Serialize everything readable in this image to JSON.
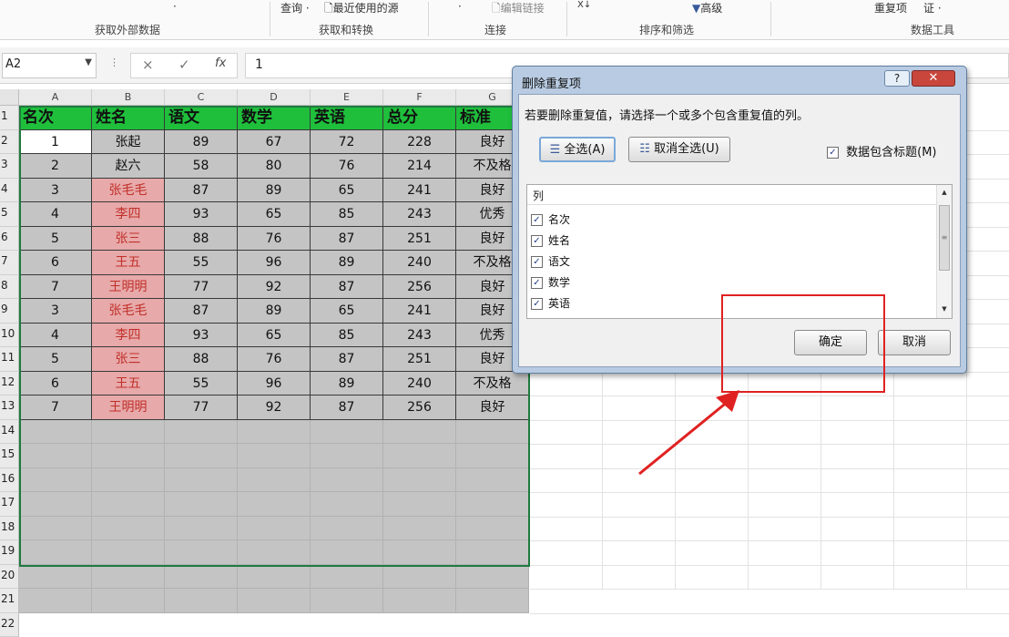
{
  "ribbon": {
    "top_items": [
      "·",
      "查询 ·",
      "最近使用的源",
      "·",
      "编辑链接",
      "X↓",
      "高级",
      "重复项",
      "证 ·"
    ],
    "groups": [
      "获取外部数据",
      "获取和转换",
      "连接",
      "排序和筛选",
      "数据工具"
    ]
  },
  "formula_bar": {
    "name_box": "A2",
    "cancel_icon": "×",
    "enter_icon": "✓",
    "fx_label": "fx",
    "value": "1"
  },
  "sheet": {
    "columns": [
      "A",
      "B",
      "C",
      "D",
      "E",
      "F",
      "G"
    ],
    "rows": [
      "1",
      "2",
      "3",
      "4",
      "5",
      "6",
      "7",
      "8",
      "9",
      "10",
      "11",
      "12",
      "13",
      "14",
      "15",
      "16",
      "17",
      "18",
      "19",
      "20",
      "21",
      "22"
    ],
    "header": [
      "名次",
      "姓名",
      "语文",
      "数学",
      "英语",
      "总分",
      "标准"
    ],
    "data": [
      [
        "1",
        "张起",
        "89",
        "67",
        "72",
        "228",
        "良好"
      ],
      [
        "2",
        "赵六",
        "58",
        "80",
        "76",
        "214",
        "不及格"
      ],
      [
        "3",
        "张毛毛",
        "87",
        "89",
        "65",
        "241",
        "良好"
      ],
      [
        "4",
        "李四",
        "93",
        "65",
        "85",
        "243",
        "优秀"
      ],
      [
        "5",
        "张三",
        "88",
        "76",
        "87",
        "251",
        "良好"
      ],
      [
        "6",
        "王五",
        "55",
        "96",
        "89",
        "240",
        "不及格"
      ],
      [
        "7",
        "王明明",
        "77",
        "92",
        "87",
        "256",
        "良好"
      ],
      [
        "3",
        "张毛毛",
        "87",
        "89",
        "65",
        "241",
        "良好"
      ],
      [
        "4",
        "李四",
        "93",
        "65",
        "85",
        "243",
        "优秀"
      ],
      [
        "5",
        "张三",
        "88",
        "76",
        "87",
        "251",
        "良好"
      ],
      [
        "6",
        "王五",
        "55",
        "96",
        "89",
        "240",
        "不及格"
      ],
      [
        "7",
        "王明明",
        "77",
        "92",
        "87",
        "256",
        "良好"
      ]
    ],
    "highlight_color": "#e7a9a9",
    "header_color": "#1fbf3c"
  },
  "dialog": {
    "title": "删除重复项",
    "help": "?",
    "close": "✕",
    "message": "若要删除重复值，请选择一个或多个包含重复值的列。",
    "select_all": "全选(A)",
    "unselect_all": "取消全选(U)",
    "has_headers": "数据包含标题(M)",
    "list_header": "列",
    "columns": [
      "名次",
      "姓名",
      "语文",
      "数学",
      "英语"
    ],
    "ok": "确定",
    "cancel": "取消"
  },
  "annotation": {
    "color": "#e02121"
  }
}
